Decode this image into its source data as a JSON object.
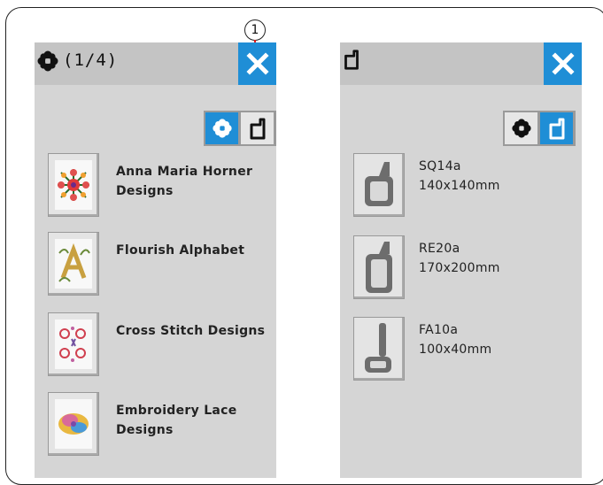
{
  "callout": {
    "number": "1"
  },
  "left_panel": {
    "title": "(1/4)",
    "title_icon": "flower-icon",
    "close_icon": "close-icon",
    "toggle": {
      "designs_icon": "flower-icon",
      "hoop_icon": "hoop-icon",
      "active": "designs"
    },
    "items": [
      {
        "icon": "flower-design-thumbnail",
        "line1": "Anna Maria Horner",
        "line2": "Designs"
      },
      {
        "icon": "alphabet-thumbnail",
        "line1": "Flourish Alphabet",
        "line2": ""
      },
      {
        "icon": "cross-stitch-thumbnail",
        "line1": "Cross Stitch Designs",
        "line2": ""
      },
      {
        "icon": "lace-thumbnail",
        "line1": "Embroidery Lace",
        "line2": "Designs"
      }
    ]
  },
  "right_panel": {
    "title": "",
    "title_icon": "hoop-icon",
    "close_icon": "close-icon",
    "toggle": {
      "designs_icon": "flower-icon",
      "hoop_icon": "hoop-icon",
      "active": "hoop"
    },
    "items": [
      {
        "icon": "hoop-sq14a-icon",
        "line1": "SQ14a",
        "line2": "140x140mm"
      },
      {
        "icon": "hoop-re20a-icon",
        "line1": "RE20a",
        "line2": "170x200mm"
      },
      {
        "icon": "hoop-fa10a-icon",
        "line1": "FA10a",
        "line2": "100x40mm"
      }
    ]
  },
  "colors": {
    "accent": "#1f8ed6",
    "panel": "#d5d5d5",
    "titlebar": "#c4c4c4",
    "callout_line": "#e2181a"
  }
}
